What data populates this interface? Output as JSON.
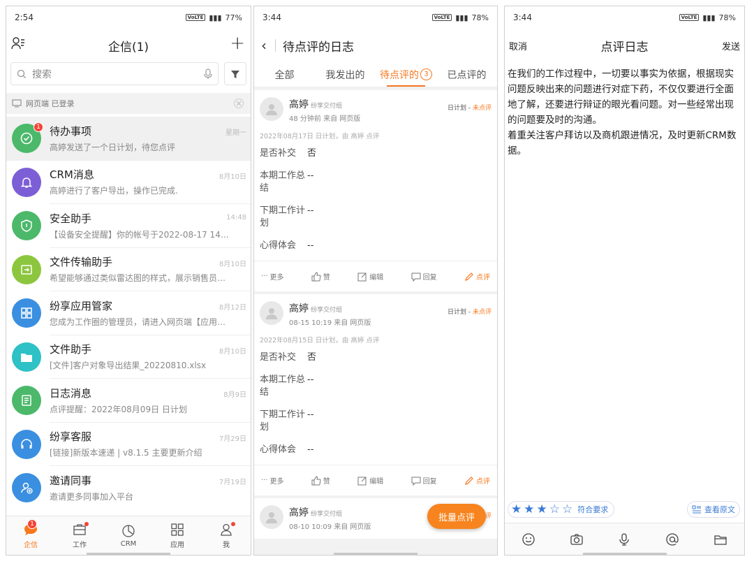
{
  "p1": {
    "status_time": "2:54",
    "status_battery": "77%",
    "title": "企信(1)",
    "search_placeholder": "搜索",
    "web_status": "网页端 已登录",
    "messages": [
      {
        "name": "待办事项",
        "text": "高婷发送了一个日计划，待您点评",
        "time": "星期一",
        "color": "#4cb86a",
        "badge": "1",
        "icon": "todo-icon"
      },
      {
        "name": "CRM消息",
        "text": "高婷进行了客户导出，操作已完成.",
        "time": "8月10日",
        "color": "#7c5fd6",
        "icon": "bell-icon"
      },
      {
        "name": "安全助手",
        "text": "【设备安全提醒】你的帐号于2022-08-17 14:48...",
        "time": "14:48",
        "color": "#4cb86a",
        "icon": "shield-icon"
      },
      {
        "name": "文件传输助手",
        "text": "希望能够通过类似雷达图的样式，展示销售员不...",
        "time": "8月10日",
        "color": "#8cc63f",
        "icon": "transfer-icon"
      },
      {
        "name": "纷享应用管家",
        "text": "您成为工作圈的管理员，请进入网页端【应用】-...",
        "time": "8月12日",
        "color": "#3a8fe0",
        "icon": "apps-icon"
      },
      {
        "name": "文件助手",
        "text": "[文件]客户对象导出结果_20220810.xlsx",
        "time": "8月10日",
        "color": "#2ec1c6",
        "icon": "folder-icon"
      },
      {
        "name": "日志消息",
        "text": "点评提醒：2022年08月09日 日计划",
        "time": "8月9日",
        "color": "#4cb86a",
        "icon": "log-icon"
      },
      {
        "name": "纷享客服",
        "text": "[链接]新版本速递 | v8.1.5 主要更新介绍",
        "time": "7月29日",
        "color": "#3a8fe0",
        "icon": "headset-icon"
      },
      {
        "name": "邀请同事",
        "text": "邀请更多同事加入平台",
        "time": "7月19日",
        "color": "#3a8fe0",
        "icon": "add-user-icon"
      }
    ],
    "tabs": [
      {
        "label": "企信",
        "badge": "1"
      },
      {
        "label": "工作"
      },
      {
        "label": "CRM"
      },
      {
        "label": "应用"
      },
      {
        "label": "我"
      }
    ]
  },
  "p2": {
    "status_time": "3:44",
    "status_battery": "78%",
    "title": "待点评的日志",
    "tabs": [
      "全部",
      "我发出的",
      "待点评的",
      "已点评的"
    ],
    "pending_count": "3",
    "cards": [
      {
        "name": "高婷",
        "group": "纷享交付组",
        "meta": "48 分钟前 来自 网页版",
        "type": "日计划",
        "state": "未点评",
        "sub": "2022年08月17日 日计划，由 高婷 点评",
        "rows": [
          [
            "是否补交",
            "否"
          ],
          [
            "本期工作总结",
            "--"
          ],
          [
            "下期工作计划",
            "--"
          ],
          [
            "心得体会",
            "--"
          ]
        ]
      },
      {
        "name": "高婷",
        "group": "纷享交付组",
        "meta": "08-15 10:19 来自 网页版",
        "type": "日计划",
        "state": "未点评",
        "sub": "2022年08月15日 日计划，由 高婷 点评",
        "rows": [
          [
            "是否补交",
            "否"
          ],
          [
            "本期工作总结",
            "--"
          ],
          [
            "下期工作计划",
            "--"
          ],
          [
            "心得体会",
            "--"
          ]
        ]
      },
      {
        "name": "高婷",
        "group": "纷享交付组",
        "meta": "08-10 10:09 来自 网页版",
        "type": "日计划",
        "state": "未点评"
      }
    ],
    "actions": {
      "more": "更多",
      "like": "赞",
      "edit": "编辑",
      "reply": "回复",
      "review": "点评"
    },
    "dash": "-",
    "fab": "批量点评"
  },
  "p3": {
    "status_time": "3:44",
    "status_battery": "78%",
    "cancel": "取消",
    "title": "点评日志",
    "send": "发送",
    "body": "在我们的工作过程中，一切要以事实为依据，根据现实问题反映出来的问题进行对症下药，不仅仅要进行全面地了解，还要进行辩证的眼光看问题。对一些经常出现的问题要及时的沟通。\n着重关注客户拜访以及商机跟进情况，及时更新CRM数据。",
    "rating_stars": 3,
    "rating_max": 5,
    "rating_label": "符合要求",
    "view_original": "查看原文"
  }
}
